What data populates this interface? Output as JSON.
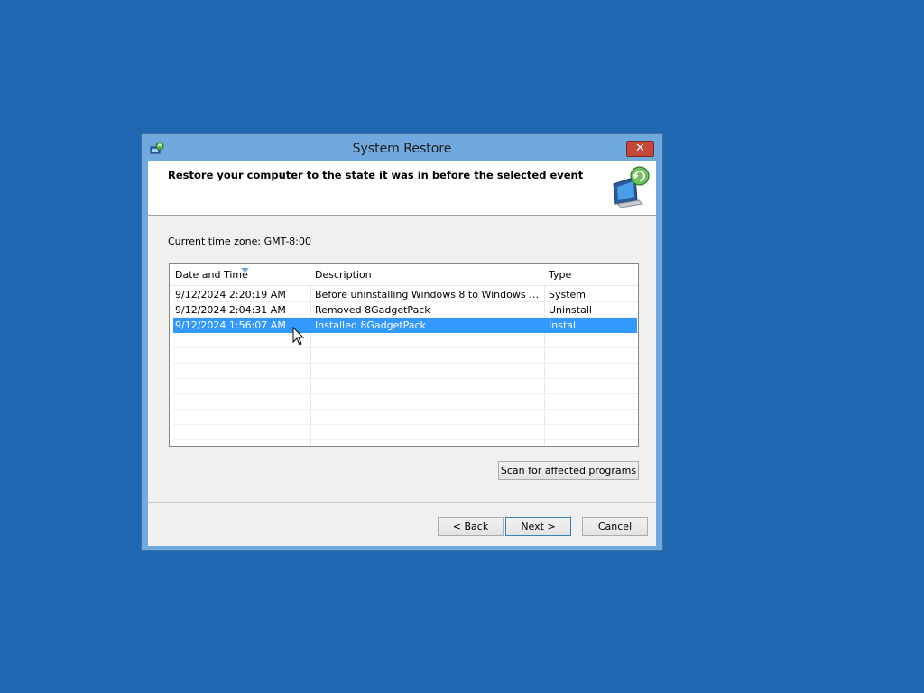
{
  "window": {
    "title": "System Restore",
    "close_label": "✕"
  },
  "header": {
    "instruction": "Restore your computer to the state it was in before the selected event"
  },
  "timezone": {
    "label": "Current time zone: GMT-8:00"
  },
  "list": {
    "columns": [
      "Date and Time",
      "Description",
      "Type"
    ],
    "rows": [
      {
        "date": "9/12/2024 2:20:19 AM",
        "description": "Before uninstalling Windows 8 to Windows 7 Tra...",
        "type": "System",
        "selected": false
      },
      {
        "date": "9/12/2024 2:04:31 AM",
        "description": "Removed 8GadgetPack",
        "type": "Uninstall",
        "selected": false
      },
      {
        "date": "9/12/2024 1:56:07 AM",
        "description": "Installed 8GadgetPack",
        "type": "Install",
        "selected": true
      }
    ]
  },
  "buttons": {
    "scan": "Scan for affected programs",
    "back": "< Back",
    "next": "Next >",
    "cancel": "Cancel"
  },
  "icons": {
    "title": "system-restore-icon",
    "header": "restore-monitor-icon",
    "cursor": "mouse-pointer-icon"
  },
  "colors": {
    "desktop": "#1f67b1",
    "selection": "#3399ff",
    "close": "#c7463a"
  }
}
